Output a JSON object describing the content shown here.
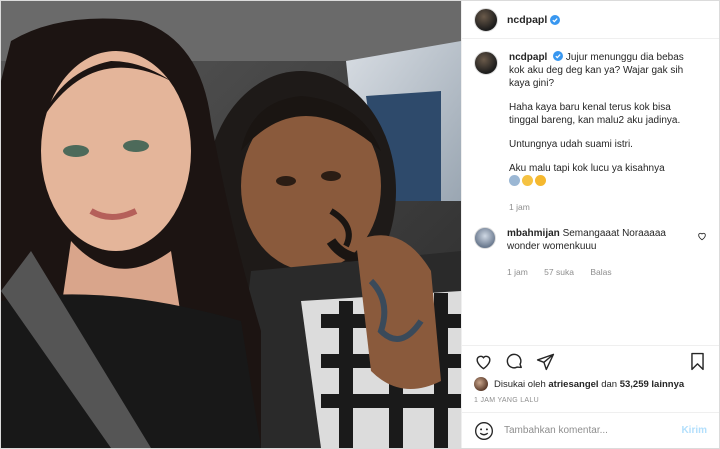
{
  "post": {
    "username": "ncdpapl",
    "caption": {
      "p1": "Jujur menunggu dia bebas kok aku deg deg kan ya? Wajar gak sih kaya gini?",
      "p2": "Haha kaya baru kenal terus kok bisa tinggal bareng, kan malu2 aku jadinya.",
      "p3": "Untungnya udah suami istri.",
      "p4": "Aku malu tapi kok lucu ya kisahnya",
      "time": "1 jam"
    },
    "reply": {
      "username": "mbahmijan",
      "text": "Semangaaat Noraaaaa wonder womenkuuu",
      "time": "1 jam",
      "likes": "57 suka",
      "reply_label": "Balas"
    },
    "likes": {
      "prefix": "Disukai oleh",
      "user": "atriesangel",
      "middle": "dan",
      "count": "53,259 lainnya"
    },
    "timestamp": "1 JAM YANG LALU",
    "comment_placeholder": "Tambahkan komentar...",
    "send_label": "Kirim"
  },
  "colors": {
    "verified": "#3897f0",
    "send_disabled": "#b2dffc",
    "muted": "#8e8e8e"
  },
  "icons": [
    "verified-icon",
    "heart-icon",
    "comment-icon",
    "share-icon",
    "bookmark-icon",
    "emoji-icon"
  ]
}
